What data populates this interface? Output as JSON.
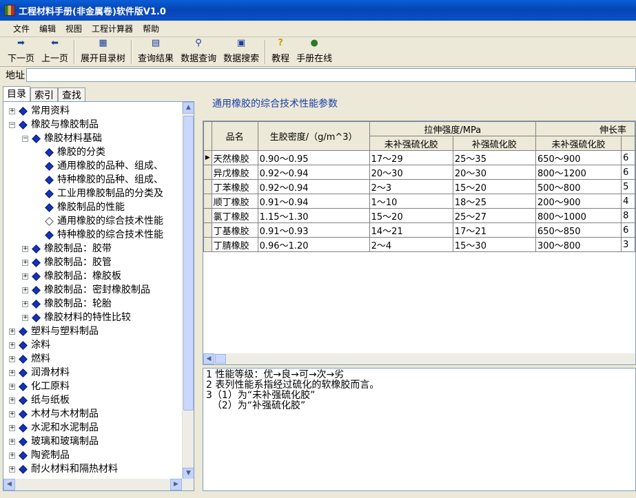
{
  "window": {
    "title": "工程材料手册(非金属卷)软件版V1.0"
  },
  "menu": [
    "文件",
    "编辑",
    "视图",
    "工程计算器",
    "帮助"
  ],
  "toolbar": {
    "next": "下一页",
    "prev": "上一页",
    "expand_tree": "展开目录树",
    "query_results": "查询结果",
    "data_query": "数据查询",
    "data_search": "数据搜索",
    "tutorial": "教程",
    "online": "手册在线"
  },
  "address": {
    "label": "地址",
    "value": ""
  },
  "tabs": [
    "目录",
    "索引",
    "查找"
  ],
  "tree": [
    {
      "label": "常用资料",
      "level": 0,
      "exp": "+"
    },
    {
      "label": "橡胶与橡胶制品",
      "level": 0,
      "exp": "-"
    },
    {
      "label": "橡胶材料基础",
      "level": 1,
      "exp": "-"
    },
    {
      "label": "橡胶的分类",
      "level": 2
    },
    {
      "label": "通用橡胶的品种、组成、",
      "level": 2
    },
    {
      "label": "特种橡胶的品种、组成、",
      "level": 2
    },
    {
      "label": "工业用橡胶制品的分类及",
      "level": 2
    },
    {
      "label": "橡胶制品的性能",
      "level": 2
    },
    {
      "label": "通用橡胶的综合技术性能",
      "level": 2,
      "open": true
    },
    {
      "label": "特种橡胶的综合技术性能",
      "level": 2
    },
    {
      "label": "橡胶制品：胶带",
      "level": 1,
      "exp": "+"
    },
    {
      "label": "橡胶制品：胶管",
      "level": 1,
      "exp": "+"
    },
    {
      "label": "橡胶制品：橡胶板",
      "level": 1,
      "exp": "+"
    },
    {
      "label": "橡胶制品：密封橡胶制品",
      "level": 1,
      "exp": "+"
    },
    {
      "label": "橡胶制品：轮胎",
      "level": 1,
      "exp": "+"
    },
    {
      "label": "橡胶材料的特性比较",
      "level": 1,
      "exp": "+"
    },
    {
      "label": "塑料与塑料制品",
      "level": 0,
      "exp": "+"
    },
    {
      "label": "涂料",
      "level": 0,
      "exp": "+"
    },
    {
      "label": "燃料",
      "level": 0,
      "exp": "+"
    },
    {
      "label": "润滑材料",
      "level": 0,
      "exp": "+"
    },
    {
      "label": "化工原料",
      "level": 0,
      "exp": "+"
    },
    {
      "label": "纸与纸板",
      "level": 0,
      "exp": "+"
    },
    {
      "label": "木材与木材制品",
      "level": 0,
      "exp": "+"
    },
    {
      "label": "水泥和水泥制品",
      "level": 0,
      "exp": "+"
    },
    {
      "label": "玻璃和玻璃制品",
      "level": 0,
      "exp": "+"
    },
    {
      "label": "陶瓷制品",
      "level": 0,
      "exp": "+"
    },
    {
      "label": "耐火材料和隔热材料",
      "level": 0,
      "exp": "+"
    }
  ],
  "doc": {
    "title": "通用橡胶的综合技术性能参数",
    "headers": {
      "name": "品名",
      "density": "生胶密度/（g/m^3）",
      "tensile": "拉伸强度/MPa",
      "elong": "伸长率",
      "unreinforced": "未补强硫化胶",
      "reinforced": "补强硫化胶",
      "unreinforced2": "未补强硫化胶"
    },
    "rows": [
      [
        "天然橡胶",
        "0.90～0.95",
        "17～29",
        "25～35",
        "650～900",
        "6"
      ],
      [
        "异戊橡胶",
        "0.92～0.94",
        "20～30",
        "20～30",
        "800～1200",
        "6"
      ],
      [
        "丁苯橡胶",
        "0.92～0.94",
        "2～3",
        "15～20",
        "500～800",
        "5"
      ],
      [
        "顺丁橡胶",
        "0.91～0.94",
        "1～10",
        "18～25",
        "200～900",
        "4"
      ],
      [
        "氯丁橡胶",
        "1.15～1.30",
        "15～20",
        "25～27",
        "800～1000",
        "8"
      ],
      [
        "丁基橡胶",
        "0.91～0.93",
        "14～21",
        "17～21",
        "650～850",
        "6"
      ],
      [
        "丁腈橡胶",
        "0.96～1.20",
        "2～4",
        "15～30",
        "300～800",
        "3"
      ]
    ],
    "notes": [
      "1 性能等级：优→良→可→次→劣",
      "2 表列性能系指经过硫化的软橡胶而言。",
      "3（1）为“未补强硫化胶”",
      "  （2）为“补强硫化胶”"
    ]
  }
}
